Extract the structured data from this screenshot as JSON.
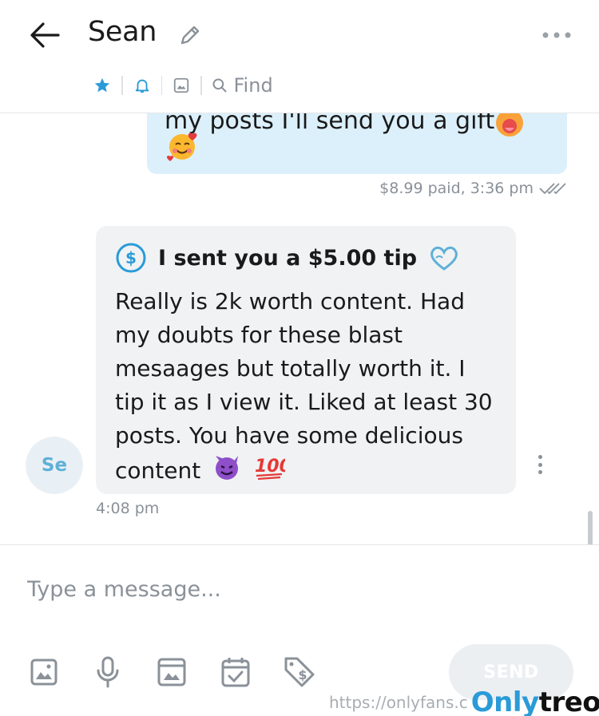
{
  "header": {
    "title": "Sean",
    "find_label": "Find"
  },
  "chat": {
    "outgoing": {
      "partial_text": "my posts I'll send you a gift !",
      "price_time": "$8.99 paid, 3:36 pm"
    },
    "incoming": {
      "avatar_initials": "Se",
      "tip_label": "I sent you a $5.00 tip",
      "message": "Really is 2k worth content. Had my doubts for these blast mesaages but totally worth it. I tip it as I view it. Liked at least 30 posts. You have some delicious content",
      "time": "4:08 pm"
    }
  },
  "composer": {
    "placeholder": "Type a message...",
    "send_label": "SEND"
  },
  "watermark": {
    "url": "https://onlyfans.c",
    "brand_part1": "Only",
    "brand_part2": "treon"
  },
  "colors": {
    "accent": "#2a9bd8",
    "outgoing_bubble": "#dcf0fb",
    "incoming_bubble": "#f0f2f4",
    "muted_text": "#8a9199"
  }
}
